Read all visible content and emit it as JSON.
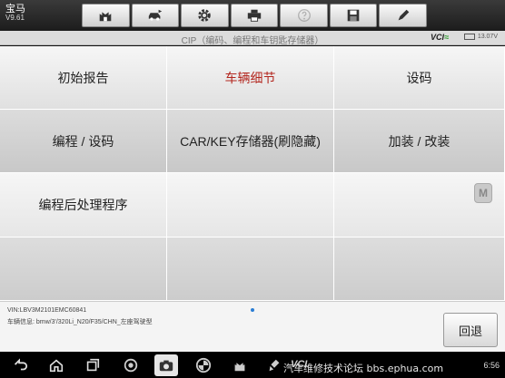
{
  "header": {
    "vehicle": "宝马",
    "version": "V9.61"
  },
  "title": {
    "text": "CIP（编码、编程和车钥匙存储器）",
    "vci": "VCI",
    "battery": "13.07V"
  },
  "menu": {
    "items": [
      {
        "label": "初始报告"
      },
      {
        "label": "车辆细节"
      },
      {
        "label": "设码"
      },
      {
        "label": "编程 / 设码"
      },
      {
        "label": "CAR/KEY存储器(刷隐藏)"
      },
      {
        "label": "加装 / 改装"
      },
      {
        "label": "编程后处理程序"
      },
      {
        "label": ""
      },
      {
        "label": ""
      },
      {
        "label": ""
      },
      {
        "label": ""
      },
      {
        "label": ""
      }
    ],
    "selected_index": 1
  },
  "side_button": {
    "label": "M"
  },
  "footer": {
    "vin": "VIN:LBV3M2101EMC60841",
    "info": "车辆信息: bmw/3'/320Li_N20/F35/CHN_左座驾驶型",
    "back_label": "回退"
  },
  "navbar": {
    "vci": "VCI",
    "watermark": "汽车维修技术论坛 bbs.ephua.com",
    "clock": "6:56"
  },
  "colors": {
    "selected": "#b3261e",
    "accent": "#2a9d2a"
  },
  "icons": [
    "home-icon",
    "vehicle-swap-icon",
    "settings-icon",
    "print-icon",
    "help-icon",
    "save-icon",
    "edit-icon"
  ]
}
